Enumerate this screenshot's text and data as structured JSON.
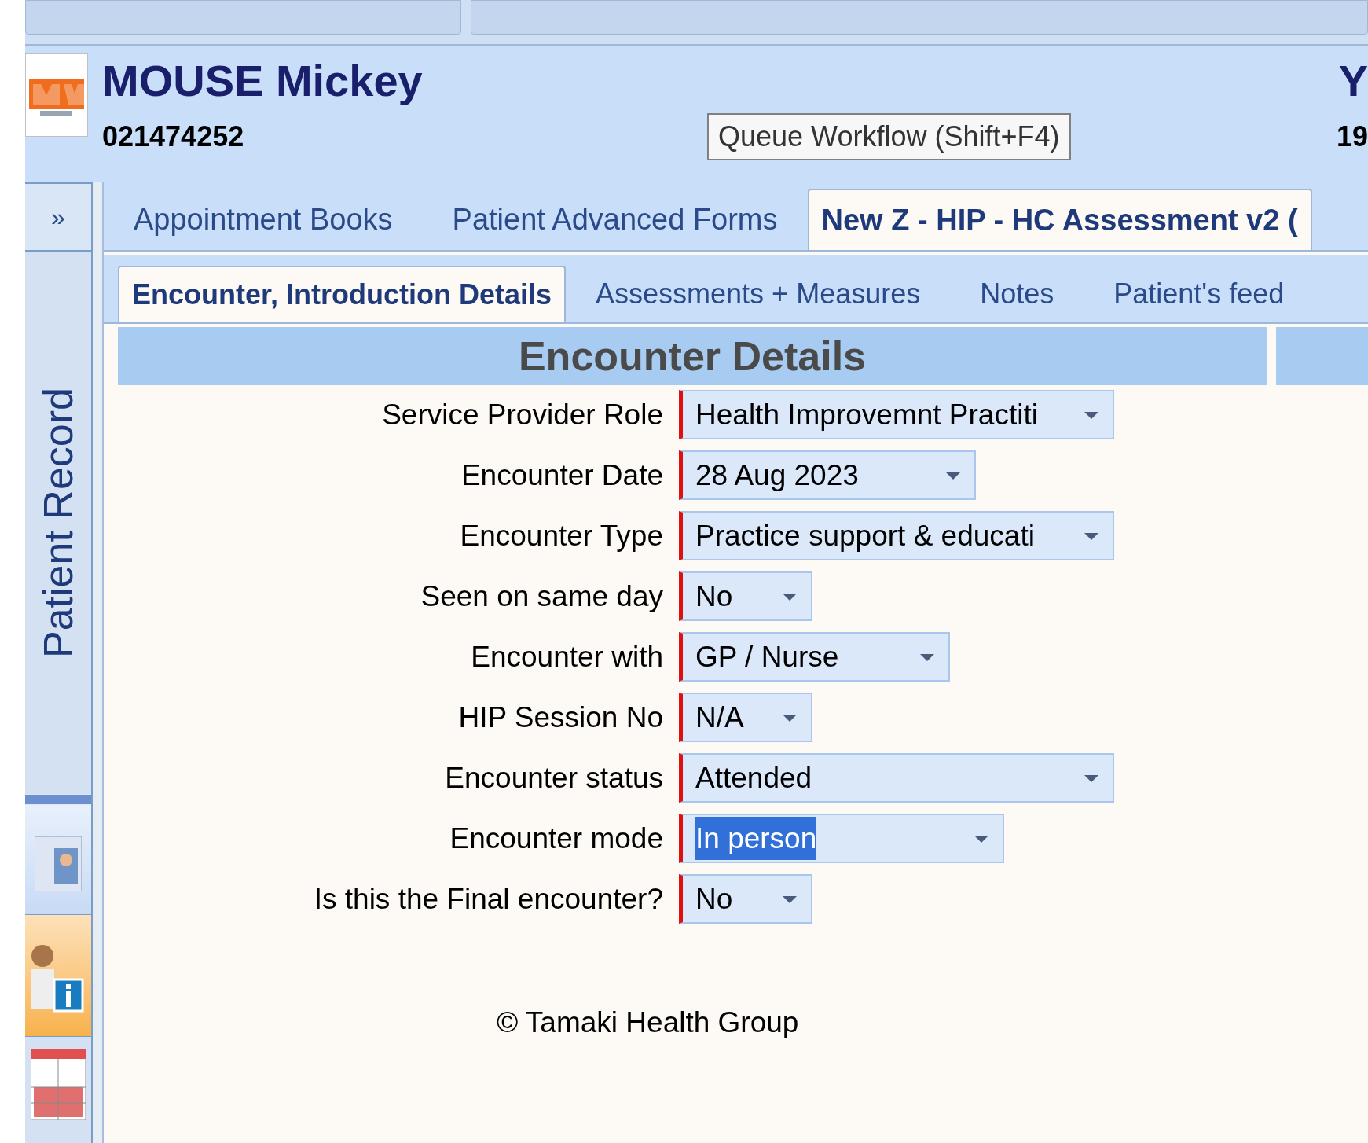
{
  "header": {
    "patient_name": "MOUSE Mickey",
    "patient_number": "021474252",
    "queue_button": "Queue Workflow (Shift+F4)",
    "right_cut_1": "Y",
    "right_cut_2": "19"
  },
  "sidebar": {
    "expand": "»",
    "title": "Patient Record"
  },
  "tabs": [
    {
      "label": "Appointment Books",
      "selected": false
    },
    {
      "label": "Patient Advanced Forms",
      "selected": false
    },
    {
      "label": "New Z - HIP - HC Assessment v2 (",
      "selected": true
    }
  ],
  "subtabs": [
    {
      "label": "Encounter, Introduction Details",
      "selected": true
    },
    {
      "label": "Assessments + Measures",
      "selected": false
    },
    {
      "label": "Notes",
      "selected": false
    },
    {
      "label": "Patient's feed",
      "selected": false
    }
  ],
  "section": {
    "title": "Encounter Details"
  },
  "fields": [
    {
      "label": "Service Provider Role",
      "value": "Health Improvemnt Practiti",
      "highlighted": false
    },
    {
      "label": "Encounter Date",
      "value": "28 Aug 2023",
      "highlighted": false
    },
    {
      "label": "Encounter Type",
      "value": "Practice support & educati",
      "highlighted": false
    },
    {
      "label": "Seen on same day",
      "value": "No",
      "highlighted": false
    },
    {
      "label": "Encounter with",
      "value": "GP / Nurse",
      "highlighted": false
    },
    {
      "label": "HIP Session No",
      "value": "N/A",
      "highlighted": false
    },
    {
      "label": "Encounter status",
      "value": "Attended",
      "highlighted": false
    },
    {
      "label": "Encounter mode",
      "value": "In person",
      "highlighted": true
    },
    {
      "label": "Is this the Final encounter?",
      "value": "No",
      "highlighted": false
    }
  ],
  "footer": {
    "copyright": "© Tamaki Health Group"
  }
}
